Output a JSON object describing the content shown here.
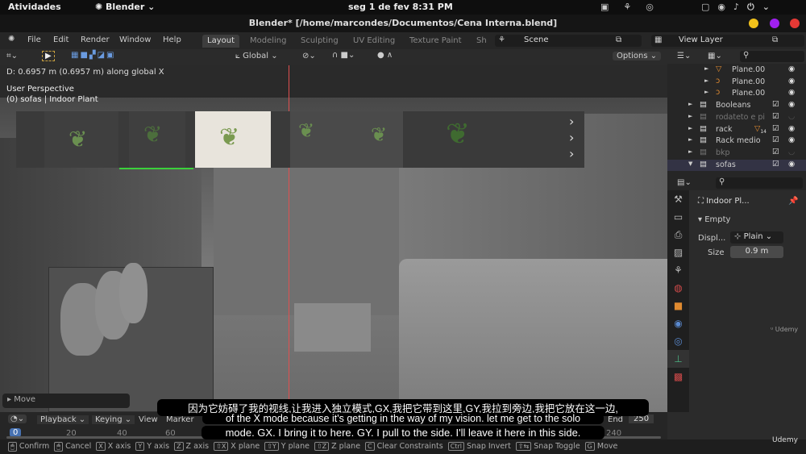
{
  "topbar": {
    "activities": "Atividades",
    "app": "Blender",
    "app_chevron": "⌄",
    "datetime": "seg 1 de fev   8:31 PM"
  },
  "window": {
    "title": "Blender* [/home/marcondes/Documentos/Cena Interna.blend]",
    "dots": [
      "#f2c21b",
      "#a020f0",
      "#e53935"
    ]
  },
  "menu": {
    "items": [
      "File",
      "Edit",
      "Render",
      "Window",
      "Help"
    ],
    "tabs": [
      "Layout",
      "Modeling",
      "Sculpting",
      "UV Editing",
      "Texture Paint",
      "Sh"
    ],
    "active_tab": "Layout",
    "scene": "Scene",
    "view_layer": "View Layer"
  },
  "viewport_toolbar": {
    "orientation": "Global",
    "options": "Options"
  },
  "viewport": {
    "op_info": "D: 0.6957 m (0.6957 m) along global X",
    "perspective": "User Perspective",
    "context": "(0) sofas | Indoor Plant",
    "move_panel": "Move"
  },
  "outliner": {
    "rows": [
      {
        "name": "Plane.00",
        "type": "mesh",
        "indent": 3,
        "visible": true,
        "checkbox": false
      },
      {
        "name": "Plane.00",
        "type": "curve",
        "indent": 3,
        "visible": true,
        "checkbox": false
      },
      {
        "name": "Plane.00",
        "type": "curve",
        "indent": 3,
        "visible": true,
        "checkbox": false
      },
      {
        "name": "Booleans",
        "type": "collection",
        "indent": 2,
        "visible": true,
        "checkbox": true
      },
      {
        "name": "rodateto e pi",
        "type": "collection",
        "indent": 2,
        "visible": false,
        "checkbox": true
      },
      {
        "name": "rack",
        "type": "collection",
        "indent": 2,
        "visible": true,
        "checkbox": true,
        "badge": "14"
      },
      {
        "name": "Rack medio",
        "type": "collection",
        "indent": 2,
        "visible": true,
        "checkbox": true
      },
      {
        "name": "bkp",
        "type": "collection",
        "indent": 2,
        "visible": false,
        "checkbox": true
      },
      {
        "name": "sofas",
        "type": "collection",
        "indent": 2,
        "visible": true,
        "checkbox": true
      }
    ]
  },
  "properties": {
    "object": "Indoor Pl...",
    "panel": "Empty",
    "display_label": "Displ...",
    "display_value": "Plain",
    "size_label": "Size",
    "size_value": "0.9 m"
  },
  "timeline": {
    "playback": "Playback",
    "keying": "Keying",
    "view": "View",
    "marker": "Marker",
    "end_label": "End",
    "end": "250",
    "current_frame": "0",
    "ticks": [
      "20",
      "40",
      "60",
      "240"
    ]
  },
  "status": [
    {
      "key": "🖱",
      "label": "Confirm"
    },
    {
      "key": "🖱",
      "label": "Cancel"
    },
    {
      "key": "X",
      "label": "X axis"
    },
    {
      "key": "Y",
      "label": "Y axis"
    },
    {
      "key": "Z",
      "label": "Z axis"
    },
    {
      "key": "⇧X",
      "label": "X plane"
    },
    {
      "key": "⇧Y",
      "label": "Y plane"
    },
    {
      "key": "⇧Z",
      "label": "Z plane"
    },
    {
      "key": "C",
      "label": "Clear Constraints"
    },
    {
      "key": "Ctrl",
      "label": "Snap Invert"
    },
    {
      "key": "⇧⇆",
      "label": "Snap Toggle"
    },
    {
      "key": "G",
      "label": "Move"
    }
  ],
  "subtitles": {
    "zh": "因为它妨碍了我的视线,让我进入独立模式,GX,我把它带到这里,GY,我拉到旁边,我把它放在这一边,",
    "en1": "of the X mode because it's getting in the way of my vision. let me get to the solo",
    "en2": "mode. GX. I bring it to here. GY. I pull to the side. I'll leave it here in this side."
  },
  "watermark": "Udemy"
}
